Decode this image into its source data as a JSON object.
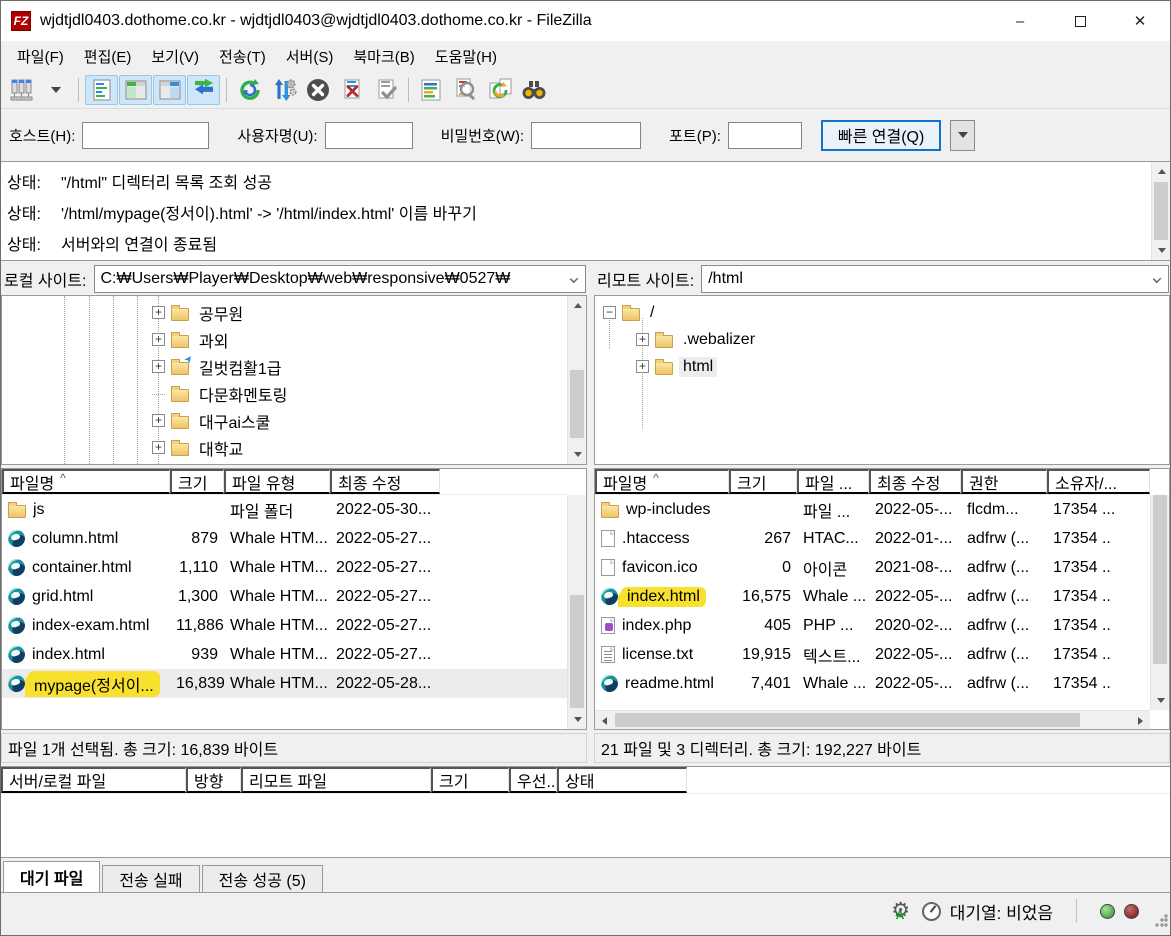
{
  "window": {
    "title": "wjdtjdl0403.dothome.co.kr - wjdtjdl0403@wjdtjdl0403.dothome.co.kr - FileZilla",
    "controls": {
      "minimize": "–",
      "maximize": "",
      "close": "✕"
    }
  },
  "menu": {
    "items": [
      {
        "label": "파일(F)"
      },
      {
        "label": "편집(E)"
      },
      {
        "label": "보기(V)"
      },
      {
        "label": "전송(T)"
      },
      {
        "label": "서버(S)"
      },
      {
        "label": "북마크(B)"
      },
      {
        "label": "도움말(H)"
      }
    ]
  },
  "quickconnect": {
    "host_label": "호스트(H):",
    "host_value": "",
    "user_label": "사용자명(U):",
    "user_value": "",
    "pass_label": "비밀번호(W):",
    "pass_value": "",
    "port_label": "포트(P):",
    "port_value": "",
    "connect_label": "빠른 연결(Q)"
  },
  "message_log": {
    "lines": [
      {
        "prefix": "상태:",
        "text": "\"/html\" 디렉터리 목록 조회 성공"
      },
      {
        "prefix": "상태:",
        "text": "'/html/mypage(정서이).html' -> '/html/index.html' 이름 바꾸기"
      },
      {
        "prefix": "상태:",
        "text": "서버와의 연결이 종료됨"
      }
    ]
  },
  "local": {
    "site_label": "로컬 사이트:",
    "site_path": "C:₩Users₩Player₩Desktop₩web₩responsive₩0527₩",
    "tree": [
      {
        "exp": "plus",
        "label": "공무원"
      },
      {
        "exp": "plus",
        "label": "과외"
      },
      {
        "exp": "plus",
        "label": "길벗컴활1급",
        "link": "linked"
      },
      {
        "exp": "line",
        "label": "다문화멘토링"
      },
      {
        "exp": "plus",
        "label": "대구ai스쿨"
      },
      {
        "exp": "plus",
        "label": "대학교"
      }
    ],
    "columns": [
      {
        "label": "파일명",
        "sorted": "sorted"
      },
      {
        "label": "크기",
        "align": "r"
      },
      {
        "label": "파일 유형"
      },
      {
        "label": "최종 수정"
      }
    ],
    "files": [
      {
        "icon": "icon-folder",
        "icon_name": "folder-icon",
        "name": "js",
        "size": "",
        "type": "파일 폴더",
        "modified": "2022-05-30..."
      },
      {
        "icon": "icon-whale",
        "icon_name": "whale-html-file-icon",
        "name": "column.html",
        "size": "879",
        "type": "Whale HTM...",
        "modified": "2022-05-27..."
      },
      {
        "icon": "icon-whale",
        "icon_name": "whale-html-file-icon",
        "name": "container.html",
        "size": "1,110",
        "type": "Whale HTM...",
        "modified": "2022-05-27..."
      },
      {
        "icon": "icon-whale",
        "icon_name": "whale-html-file-icon",
        "name": "grid.html",
        "size": "1,300",
        "type": "Whale HTM...",
        "modified": "2022-05-27..."
      },
      {
        "icon": "icon-whale",
        "icon_name": "whale-html-file-icon",
        "name": "index-exam.html",
        "size": "11,886",
        "type": "Whale HTM...",
        "modified": "2022-05-27..."
      },
      {
        "icon": "icon-whale",
        "icon_name": "whale-html-file-icon",
        "name": "index.html",
        "size": "939",
        "type": "Whale HTM...",
        "modified": "2022-05-27..."
      },
      {
        "icon": "icon-whale",
        "icon_name": "whale-html-file-icon",
        "name": "mypage(정서이...",
        "size": "16,839",
        "type": "Whale HTM...",
        "modified": "2022-05-28...",
        "state": "selected",
        "hl": "highlight"
      }
    ],
    "status": "파일 1개 선택됨. 총 크기: 16,839 바이트"
  },
  "remote": {
    "site_label": "리모트 사이트:",
    "site_path": "/html",
    "tree": [
      {
        "exp": "minus",
        "depth": "d0",
        "label": "/"
      },
      {
        "exp": "plus",
        "depth": "d1",
        "label": ".webalizer"
      },
      {
        "exp": "plus",
        "depth": "d1",
        "label": "html",
        "state": "selected"
      }
    ],
    "columns": [
      {
        "label": "파일명",
        "sorted": "sorted"
      },
      {
        "label": "크기",
        "align": "r"
      },
      {
        "label": "파일 ..."
      },
      {
        "label": "최종 수정"
      },
      {
        "label": "권한"
      },
      {
        "label": "소유자/..."
      }
    ],
    "files": [
      {
        "icon": "icon-folder",
        "icon_name": "folder-icon",
        "name": "wp-includes",
        "size": "",
        "type": "파일 ...",
        "modified": "2022-05-...",
        "perm": "flcdm...",
        "owner": "17354 ..."
      },
      {
        "icon": "icon-file",
        "icon_name": "file-icon",
        "name": ".htaccess",
        "size": "267",
        "type": "HTAC...",
        "modified": "2022-01-...",
        "perm": "adfrw (...",
        "owner": "17354 .."
      },
      {
        "icon": "icon-file",
        "icon_name": "file-icon",
        "name": "favicon.ico",
        "size": "0",
        "type": "아이콘",
        "modified": "2021-08-...",
        "perm": "adfrw (...",
        "owner": "17354 .."
      },
      {
        "icon": "icon-whale",
        "icon_name": "whale-html-file-icon",
        "name": "index.html",
        "size": "16,575",
        "type": "Whale ...",
        "modified": "2022-05-...",
        "perm": "adfrw (...",
        "owner": "17354 ..",
        "hl": "highlight"
      },
      {
        "icon": "icon-php",
        "icon_name": "php-file-icon",
        "name": "index.php",
        "size": "405",
        "type": "PHP ...",
        "modified": "2020-02-...",
        "perm": "adfrw (...",
        "owner": "17354 .."
      },
      {
        "icon": "icon-text",
        "icon_name": "text-file-icon",
        "name": "license.txt",
        "size": "19,915",
        "type": "텍스트...",
        "modified": "2022-05-...",
        "perm": "adfrw (...",
        "owner": "17354 .."
      },
      {
        "icon": "icon-whale",
        "icon_name": "whale-html-file-icon",
        "name": "readme.html",
        "size": "7,401",
        "type": "Whale ...",
        "modified": "2022-05-...",
        "perm": "adfrw (...",
        "owner": "17354 .."
      }
    ],
    "status": "21 파일 및 3 디렉터리. 총 크기: 192,227 바이트"
  },
  "queue": {
    "columns": [
      {
        "label": "서버/로컬 파일"
      },
      {
        "label": "방향"
      },
      {
        "label": "리모트 파일"
      },
      {
        "label": "크기",
        "align": "r"
      },
      {
        "label": "우선..."
      },
      {
        "label": "상태"
      }
    ]
  },
  "tabs": [
    {
      "label": "대기 파일",
      "state": "active"
    },
    {
      "label": "전송 실패"
    },
    {
      "label": "전송 성공 (5)"
    }
  ],
  "statusbar": {
    "queue_text": "대기열: 비었음"
  }
}
